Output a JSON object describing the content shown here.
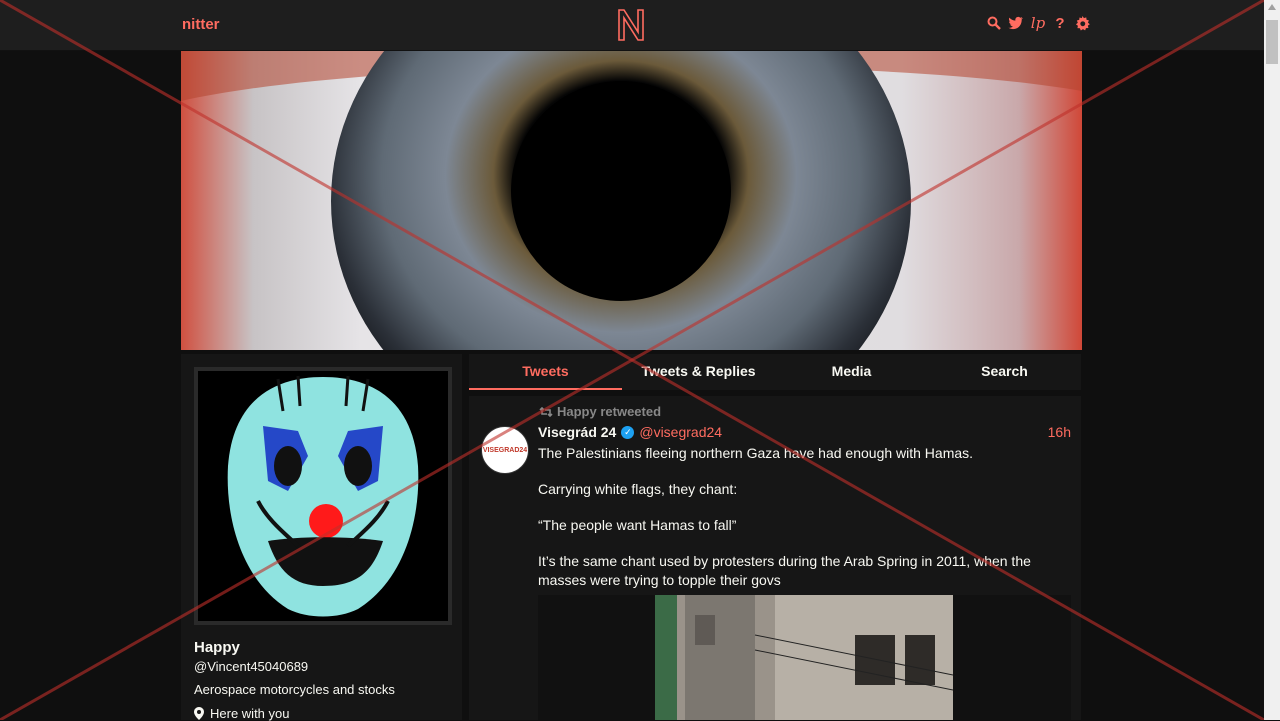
{
  "nav": {
    "brand": "nitter",
    "logo_letter": "N",
    "icons": [
      "search-icon",
      "twitter-bird-icon",
      "lp-icon",
      "help-icon",
      "settings-icon"
    ],
    "lp_label": "lp",
    "help_label": "?"
  },
  "profile": {
    "name": "Happy",
    "handle": "@Vincent45040689",
    "bio": "Aerospace motorcycles and stocks",
    "location": "Here with you"
  },
  "tabs": [
    {
      "label": "Tweets",
      "active": true
    },
    {
      "label": "Tweets & Replies",
      "active": false
    },
    {
      "label": "Media",
      "active": false
    },
    {
      "label": "Search",
      "active": false
    }
  ],
  "tweet": {
    "retweet_label": "Happy retweeted",
    "avatar_text": "VISEGRAD24",
    "display_name": "Visegrád 24",
    "username": "@visegrad24",
    "date": "16h",
    "paragraphs": [
      "The Palestinians fleeing northern Gaza have had enough with Hamas.",
      "Carrying white flags, they chant:",
      "“The people want Hamas to fall”",
      "It’s the same chant used by protesters during the Arab Spring in 2011, when the masses were trying to topple their govs"
    ]
  },
  "colors": {
    "accent": "#ff6c60",
    "background": "#0f0f0f",
    "panel": "#161616",
    "navbar": "#1e1e1e",
    "verified": "#1da1f2",
    "cross": "#c0302a"
  }
}
